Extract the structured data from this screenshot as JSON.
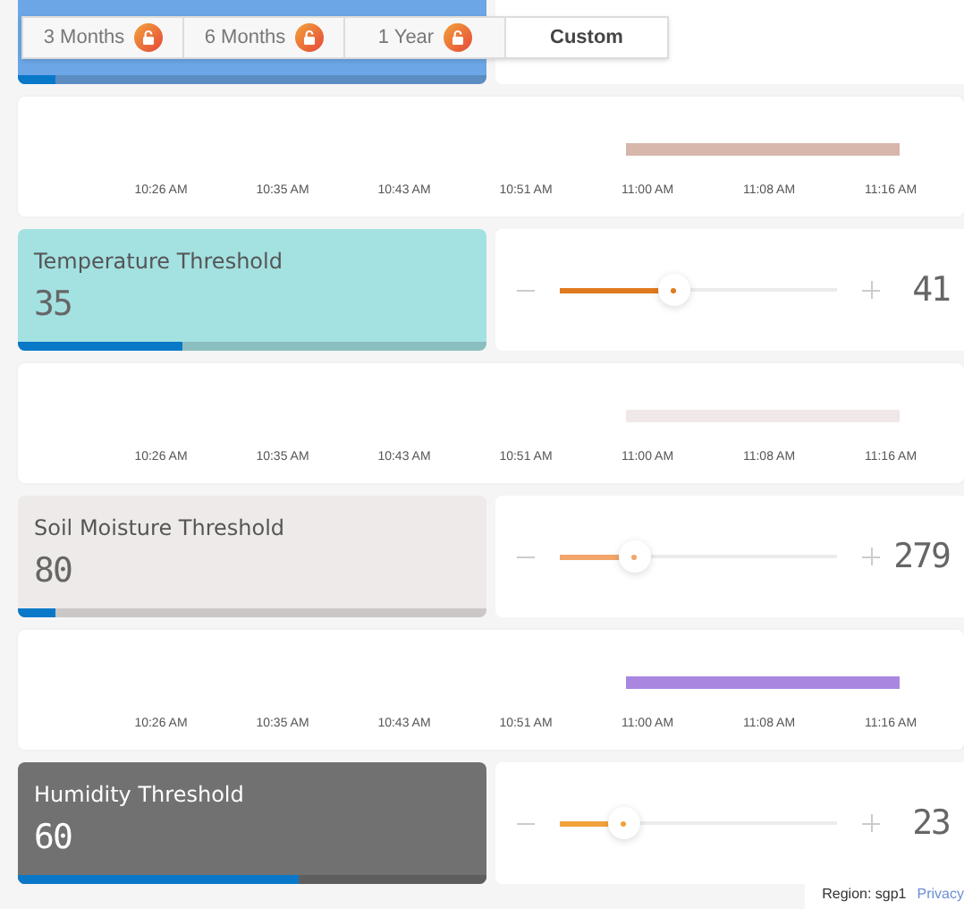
{
  "range_tabs": [
    {
      "label": "3 Months",
      "locked": true,
      "selected": false
    },
    {
      "label": "6 Months",
      "locked": true,
      "selected": false
    },
    {
      "label": "1 Year",
      "locked": true,
      "selected": false
    },
    {
      "label": "Custom",
      "locked": false,
      "selected": true
    }
  ],
  "widgets": [
    {
      "kind": "partial",
      "color": "#6ca6e6",
      "level": 0.08
    },
    {
      "kind": "chart",
      "color": "#d7b6ab",
      "ticks": [
        "10:26 AM",
        "10:35 AM",
        "10:43 AM",
        "10:51 AM",
        "11:00 AM",
        "11:08 AM",
        "11:16 AM"
      ]
    },
    {
      "kind": "threshold",
      "title": "Temperature Threshold",
      "value": "35",
      "color": "#a4e1e1",
      "dark": false,
      "level": 0.35,
      "slider": {
        "level": 0.41,
        "color": "#e07a1f",
        "reading": "41"
      }
    },
    {
      "kind": "chart",
      "color": "#f0e8e8",
      "ticks": [
        "10:26 AM",
        "10:35 AM",
        "10:43 AM",
        "10:51 AM",
        "11:00 AM",
        "11:08 AM",
        "11:16 AM"
      ]
    },
    {
      "kind": "threshold",
      "title": "Soil Moisture Threshold",
      "value": "80",
      "color": "#eeeae9",
      "dark": false,
      "level": 0.08,
      "slider": {
        "level": 0.27,
        "color": "#f2a66a",
        "reading": "279"
      }
    },
    {
      "kind": "chart",
      "color": "#a987e0",
      "ticks": [
        "10:26 AM",
        "10:35 AM",
        "10:43 AM",
        "10:51 AM",
        "11:00 AM",
        "11:08 AM",
        "11:16 AM"
      ]
    },
    {
      "kind": "threshold",
      "title": "Humidity Threshold",
      "value": "60",
      "color": "#717171",
      "dark": true,
      "level": 0.6,
      "slider": {
        "level": 0.23,
        "color": "#f2a23c",
        "reading": "23"
      }
    }
  ],
  "footer": {
    "region": "Region: sgp1",
    "link": "Privacy"
  }
}
